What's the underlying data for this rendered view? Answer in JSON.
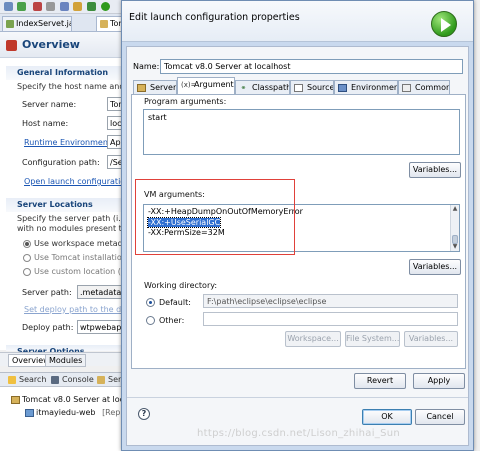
{
  "ide": {
    "editor_tabs": [
      "IndexServet.java",
      "Tomc"
    ],
    "overview_title": "Overview",
    "general_information": {
      "title": "General Information",
      "desc": "Specify the host name and ot",
      "server_name_label": "Server name:",
      "server_name_value": "Tor",
      "host_name_label": "Host name:",
      "host_name_value": "loc",
      "runtime_env_link": "Runtime Environment:",
      "runtime_env_value": "Apa",
      "config_path_label": "Configuration path:",
      "config_path_value": "/Se",
      "open_launch_link": "Open launch configuration"
    },
    "server_locations": {
      "title": "Server Locations",
      "desc_line1": "Specify the server path (i.e. c",
      "desc_line2": "with no modules present to m",
      "options": [
        "Use workspace metadata",
        "Use Tomcat installation (ta",
        "Use custom location (doe"
      ],
      "selected_option": 0,
      "server_path_label": "Server path:",
      "server_path_value": ".metadata\\.p",
      "set_deploy_link": "Set deploy path to the defaul",
      "deploy_path_label": "Deploy path:",
      "deploy_path_value": "wtpwebapps"
    },
    "server_options_title": "Server Options",
    "bottom_tabs": [
      "Overview",
      "Modules"
    ],
    "view_tabs": [
      "Search",
      "Console",
      "Serv"
    ],
    "server_tree": {
      "server": "Tomcat v8.0 Server at local",
      "module": "itmayiedu-web",
      "module_status": "[Repu"
    }
  },
  "dialog": {
    "title": "Edit launch configuration properties",
    "name_label": "Name:",
    "name_value": "Tomcat v8.0 Server at localhost",
    "tabs": [
      {
        "label": "Server",
        "icon": "server-icon"
      },
      {
        "label": "Arguments",
        "icon": "arguments-icon"
      },
      {
        "label": "Classpath",
        "icon": "classpath-icon"
      },
      {
        "label": "Source",
        "icon": "source-icon"
      },
      {
        "label": "Environment",
        "icon": "environment-icon"
      },
      {
        "label": "Common",
        "icon": "common-icon"
      }
    ],
    "active_tab": "Arguments",
    "program_arguments": {
      "label": "Program arguments:",
      "value": "start",
      "variables_button": "Variables..."
    },
    "vm_arguments": {
      "label": "VM arguments:",
      "lines": [
        "-XX:+HeapDumpOnOutOfMemoryError",
        "-XX:+UseSerialGC",
        "-XX:PermSize=32M"
      ],
      "selected_line": 1,
      "variables_button": "Variables..."
    },
    "working_directory": {
      "label": "Working directory:",
      "default_label": "Default:",
      "default_value": "F:\\path\\eclipse\\eclipse\\eclipse",
      "other_label": "Other:",
      "other_value": "",
      "selected": "default",
      "buttons": [
        "Workspace...",
        "File System...",
        "Variables..."
      ]
    },
    "revert_button": "Revert",
    "apply_button": "Apply",
    "ok_button": "OK",
    "cancel_button": "Cancel",
    "help_icon": "help-icon"
  },
  "watermark": "https://blog.csdn.net/Lison_zhihai_Sun",
  "colors": {
    "selection": "#2f6fd1",
    "annotation_box": "#e0413a",
    "section_title": "#19457a",
    "link": "#1a55b3"
  }
}
